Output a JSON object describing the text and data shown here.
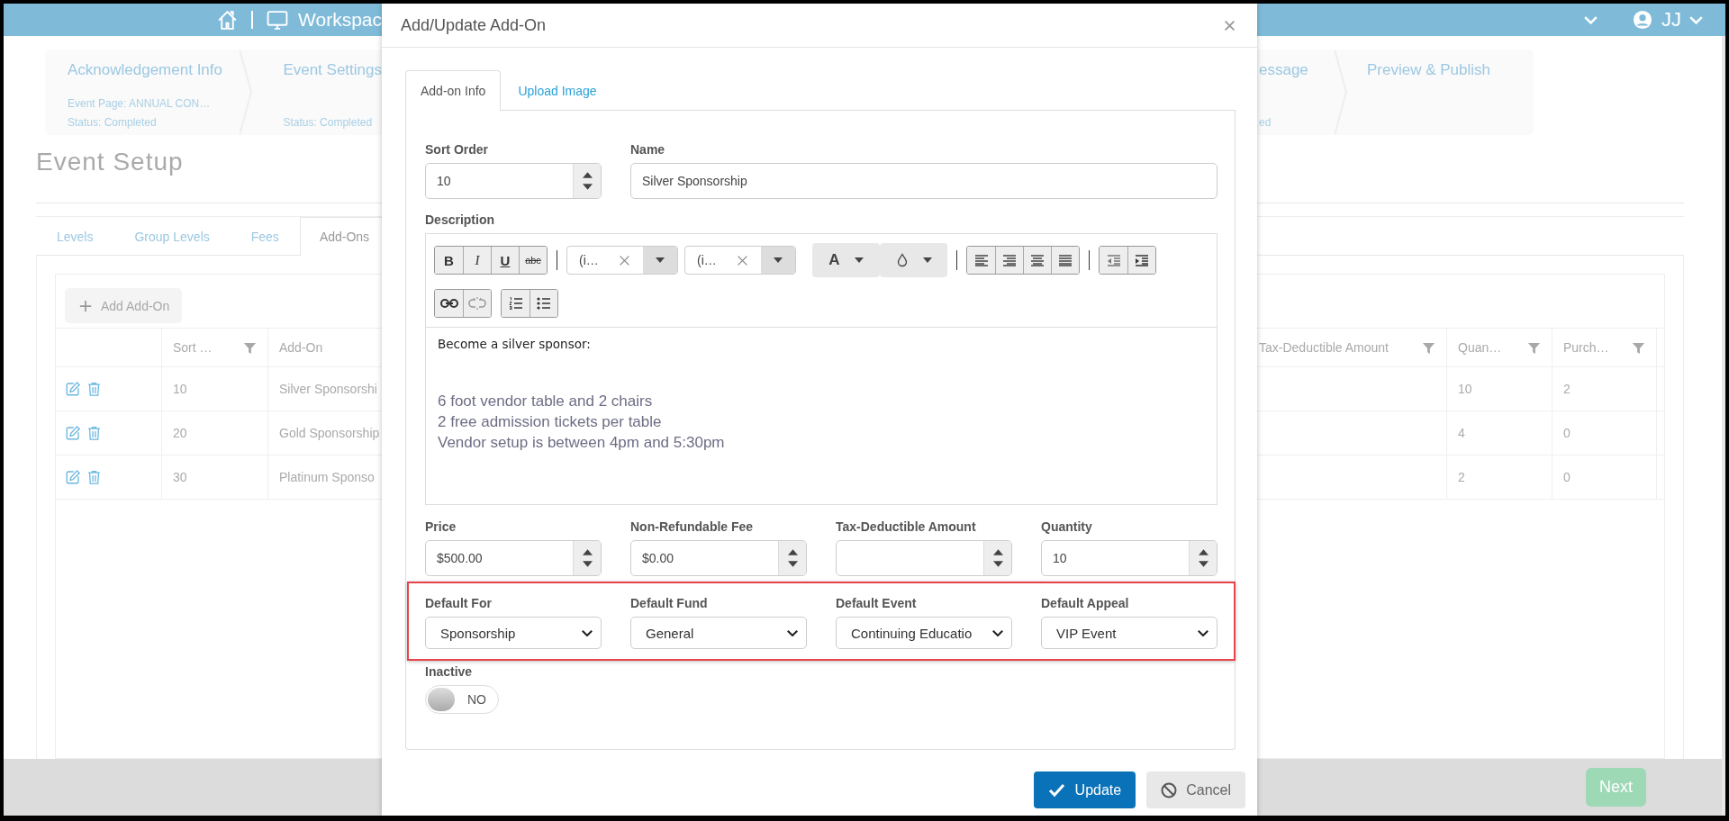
{
  "header": {
    "workspace": "Workspac",
    "user": "JJ"
  },
  "wizard": {
    "left_steps": [
      {
        "title": "Acknowledgement Info",
        "detail": "Event Page: ANNUAL CON…",
        "status": "Status: Completed"
      },
      {
        "title": "Event Settings",
        "status": "Status: Completed"
      }
    ],
    "right_steps": [
      {
        "title": "essage",
        "status": "ed"
      },
      {
        "title": "Preview & Publish"
      }
    ]
  },
  "page_title": "Event Setup",
  "tabs": [
    {
      "label": "Levels",
      "selected": false
    },
    {
      "label": "Group Levels",
      "selected": false
    },
    {
      "label": "Fees",
      "selected": false
    },
    {
      "label": "Add-Ons",
      "selected": true
    }
  ],
  "add_button": "Add Add-On",
  "table": {
    "columns": [
      {
        "label": "Sort …",
        "filter": true
      },
      {
        "label": "Add-On",
        "filter": false
      },
      {
        "label": "Tax-Deductible Amount",
        "filter": true
      },
      {
        "label": "Quan…",
        "filter": true
      },
      {
        "label": "Purch…",
        "filter": true
      }
    ],
    "rows": [
      {
        "sort": "10",
        "add_on": "Silver Sponsorshi",
        "quantity": "10",
        "purchased": "2"
      },
      {
        "sort": "20",
        "add_on": "Gold Sponsorship",
        "quantity": "4",
        "purchased": "0"
      },
      {
        "sort": "30",
        "add_on": "Platinum Sponso",
        "quantity": "2",
        "purchased": "0"
      }
    ]
  },
  "modal": {
    "title": "Add/Update Add-On",
    "tabs": [
      {
        "label": "Add-on Info",
        "selected": true
      },
      {
        "label": "Upload Image",
        "selected": false
      }
    ],
    "sort_order": {
      "label": "Sort Order",
      "value": "10"
    },
    "name": {
      "label": "Name",
      "value": "Silver Sponsorship"
    },
    "description": {
      "label": "Description",
      "format_buttons": [
        "B",
        "I",
        "U",
        "abc"
      ],
      "font_selects": [
        "(i…",
        "(i…"
      ],
      "color_button": "A",
      "intro": "Become a silver sponsor:",
      "lines": [
        "6 foot vendor table and 2 chairs",
        "2 free admission tickets per table",
        "Vendor setup is between 4pm and 5:30pm"
      ]
    },
    "amount_fields": [
      {
        "label": "Price",
        "value": "$500.00"
      },
      {
        "label": "Non-Refundable Fee",
        "value": "$0.00"
      },
      {
        "label": "Tax-Deductible Amount"
      },
      {
        "label": "Quantity",
        "value": "10"
      }
    ],
    "defaults": {
      "highlighted": true,
      "fields": [
        {
          "label": "Default For",
          "value": "Sponsorship"
        },
        {
          "label": "Default Fund",
          "value": "General"
        },
        {
          "label": "Default Event",
          "value": "Continuing Educatio"
        },
        {
          "label": "Default Appeal",
          "value": "VIP Event"
        }
      ]
    },
    "inactive": {
      "label": "Inactive",
      "on": false,
      "state_text": "NO"
    },
    "buttons": [
      {
        "label": "Update",
        "kind": "primary"
      },
      {
        "label": "Cancel",
        "kind": "secondary"
      }
    ]
  },
  "footer": {
    "next": "Next"
  }
}
